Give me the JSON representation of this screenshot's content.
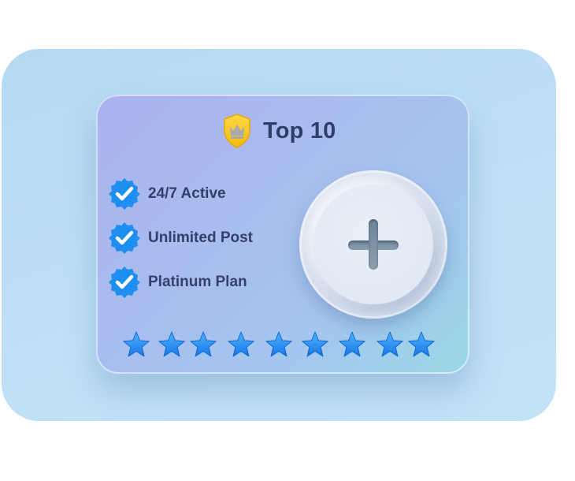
{
  "card": {
    "title": "Top 10",
    "features": [
      {
        "label": "24/7 Active",
        "icon": "verified-badge-icon"
      },
      {
        "label": "Unlimited Post",
        "icon": "verified-badge-icon"
      },
      {
        "label": "Platinum Plan",
        "icon": "verified-badge-icon"
      }
    ],
    "rating": {
      "filled_stars": 9,
      "total_stars": 9
    },
    "add_button": {
      "icon": "plus-icon"
    }
  },
  "colors": {
    "accent_blue": "#1e8ef0",
    "crown_gold": "#f5c518",
    "title_text": "#2d3e6b"
  }
}
